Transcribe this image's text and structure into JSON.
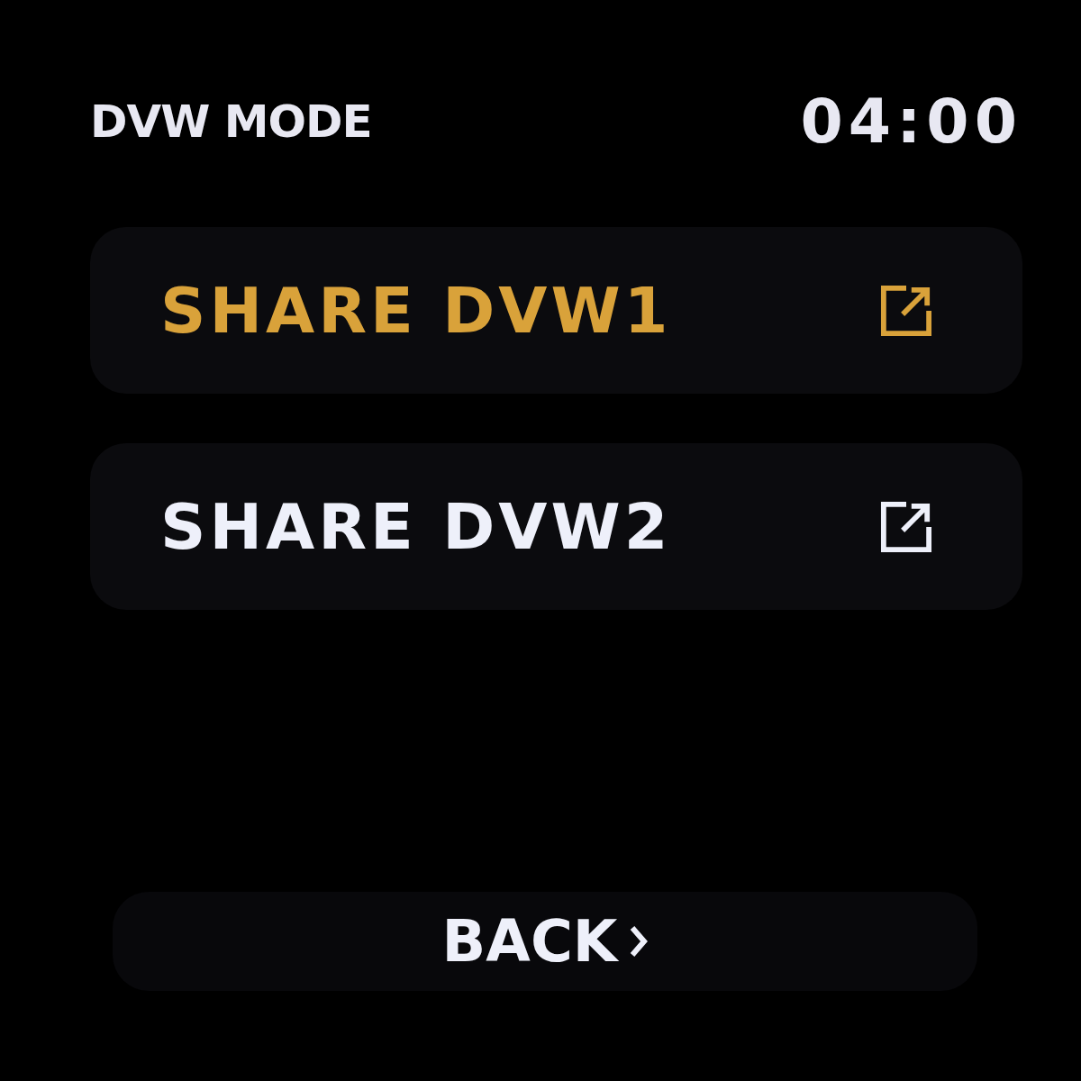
{
  "header": {
    "title": "DVW MODE",
    "time": "04:00"
  },
  "items": [
    {
      "label": "SHARE DVW1",
      "selected": true
    },
    {
      "label": "SHARE DVW2",
      "selected": false
    }
  ],
  "back_button": {
    "label": "BACK"
  }
}
